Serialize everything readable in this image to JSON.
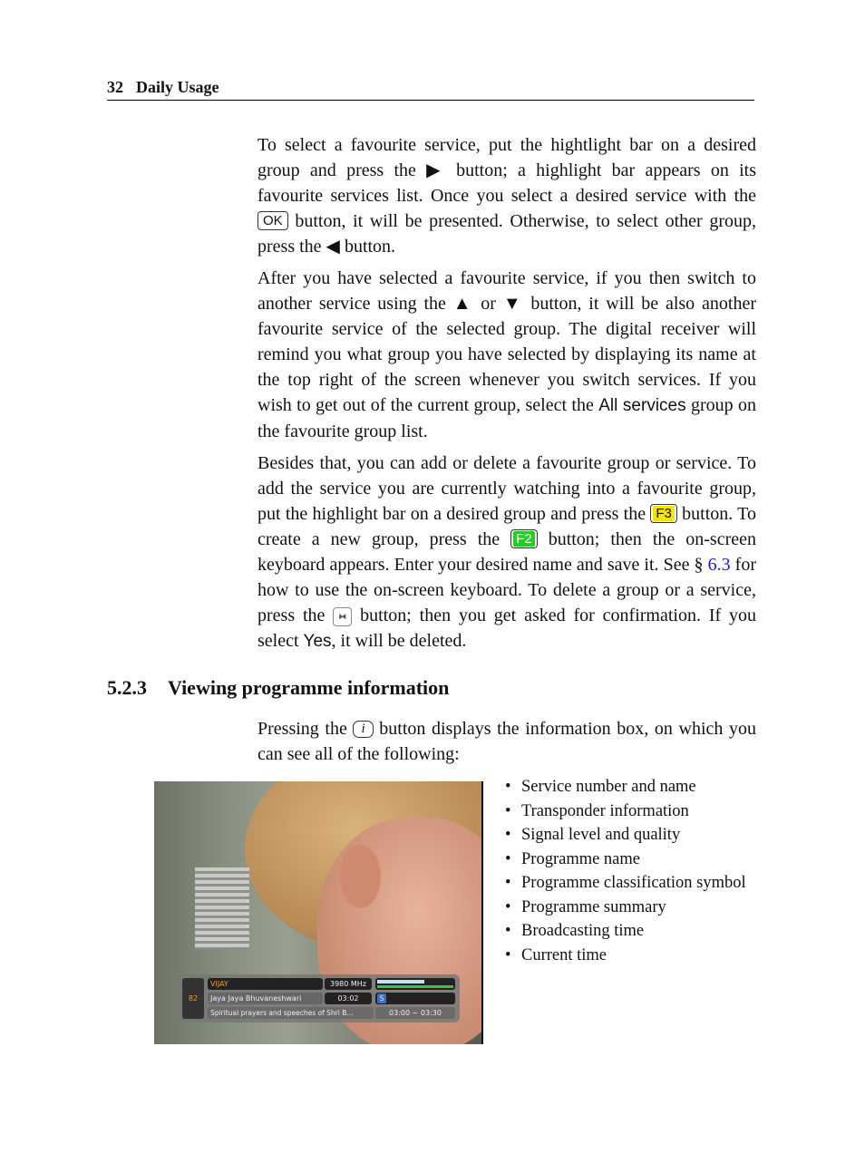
{
  "header": {
    "page_number": "32",
    "chapter": "Daily Usage"
  },
  "p1": [
    "To select a favourite service, put the hightlight bar on a desired group and press the ",
    "▶",
    " button; a highlight bar appears on its favourite services list. Once you select a desired service with the ",
    "OK",
    " button, it will be presented. Otherwise, to select other group, press the ",
    "◀",
    " button."
  ],
  "p2": [
    "After you have selected a favourite service, if you then switch to another service using the ",
    "▲",
    " or ",
    "▼",
    " button, it will be also another favourite service of the selected group. The digital receiver will remind you what group you have selected by displaying its name at the top right of the screen whenever you switch services. If you wish to get out of the current group, select the ",
    "All services",
    " group on the favourite group list."
  ],
  "p3": [
    "Besides that, you can add or delete a favourite group or service. To add the service you are currently watching into a favourite group, put the highlight bar on a desired group and press the ",
    "F3",
    " button. To create a new group, press the ",
    "F2",
    " button; then the on-screen keyboard appears. Enter your desired name and save it. See § ",
    "6.3",
    " for how to use the on-screen keyboard. To delete a group or a service, press the ",
    "⧓",
    " button; then you get asked for confirmation. If you select ",
    "Yes",
    ", it will be deleted."
  ],
  "section": {
    "number": "5.2.3",
    "title": "Viewing programme information"
  },
  "p4": [
    "Pressing the ",
    "i",
    " button displays the information box, on which you can see all of the following:"
  ],
  "info_box": {
    "service_number": "82",
    "service_name": "VIJAY",
    "frequency": "3980 MHz",
    "programme": "Jaya Jaya Bhuvaneshwari",
    "current_time": "03:02",
    "summary": "Spiritual prayers and speeches of Shri B...",
    "broadcast_time": "03:00 ~ 03:30",
    "class_symbol": "S",
    "signal_level": 0.6,
    "signal_quality": 1.0
  },
  "list": [
    "Service number and name",
    "Transponder information",
    "Signal level and quality",
    "Programme name",
    "Programme classification symbol",
    "Programme summary",
    "Broadcasting time",
    "Current time"
  ],
  "colors": {
    "f3": "#f5e400",
    "f2": "#22d022",
    "link": "#1a1adf"
  }
}
